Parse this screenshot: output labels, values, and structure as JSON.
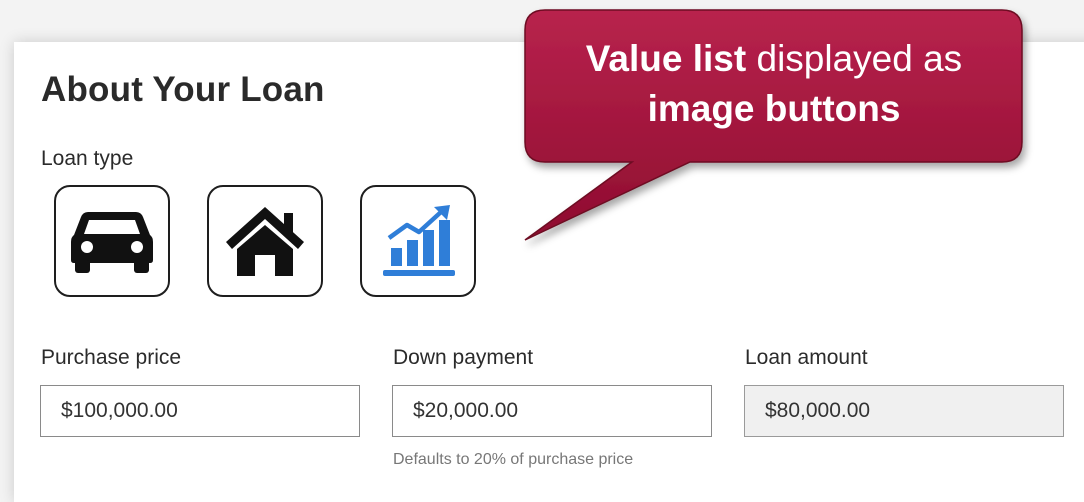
{
  "form": {
    "title": "About Your Loan",
    "loan_type_label": "Loan type",
    "loan_types": [
      {
        "icon": "car-icon"
      },
      {
        "icon": "house-icon"
      },
      {
        "icon": "growth-chart-icon",
        "color": "#2f7ed8"
      }
    ],
    "purchase_price": {
      "label": "Purchase price",
      "value": "$100,000.00"
    },
    "down_payment": {
      "label": "Down payment",
      "value": "$20,000.00",
      "hint": "Defaults to 20% of purchase price"
    },
    "loan_amount": {
      "label": "Loan amount",
      "value": "$80,000.00"
    }
  },
  "callout": {
    "bold_1": "Value list",
    "text_1": " displayed as",
    "bold_2": "image buttons",
    "color": "#9b1035"
  }
}
